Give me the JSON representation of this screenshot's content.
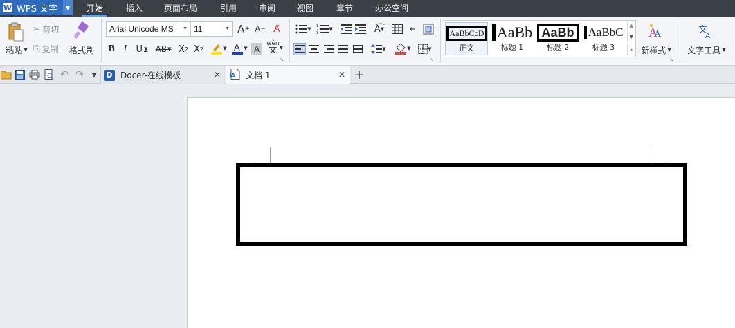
{
  "app": {
    "logo": "W",
    "name": "WPS 文字"
  },
  "menu": {
    "tabs": [
      "开始",
      "插入",
      "页面布局",
      "引用",
      "审阅",
      "视图",
      "章节",
      "办公空间"
    ],
    "active": "开始"
  },
  "ribbon": {
    "clipboard": {
      "paste": "粘贴",
      "cut": "剪切",
      "copy": "复制",
      "format_painter": "格式刷"
    },
    "font": {
      "name": "Arial Unicode MS",
      "size": "11"
    },
    "styles": [
      {
        "preview": "AaBbCcD",
        "label": "正文"
      },
      {
        "preview": "AaBb",
        "label": "标题 1"
      },
      {
        "preview": "AaBb",
        "label": "标题 2"
      },
      {
        "preview": "AaBbC",
        "label": "标题 3"
      }
    ],
    "new_style": "新样式",
    "text_tools": "文字工具"
  },
  "tabs": [
    {
      "title": "Docer-在线模板",
      "active": false
    },
    {
      "title": "文档 1",
      "active": true
    }
  ],
  "colors": {
    "menubar": "#3b3f46",
    "accent": "#2e6bbf",
    "font_color_bar": "#1f3fd0",
    "highlight": "#ffe600"
  }
}
